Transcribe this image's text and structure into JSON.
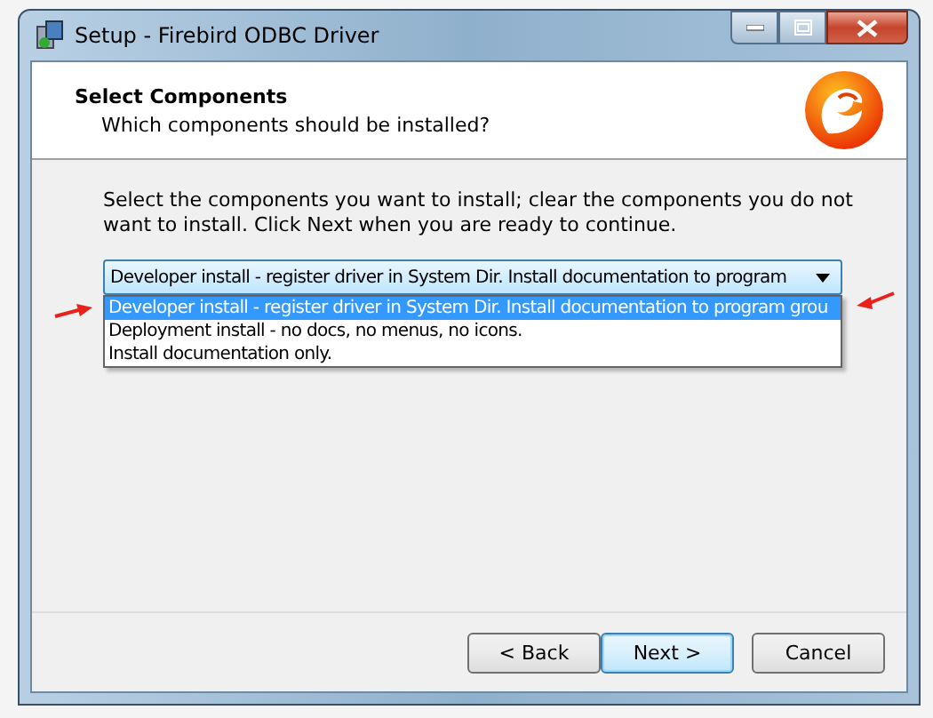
{
  "window": {
    "title": "Setup - Firebird ODBC Driver"
  },
  "header": {
    "title": "Select Components",
    "subtitle": "Which components should be installed?"
  },
  "instructions": "Select the components you want to install; clear the components you do not want to install. Click Next when you are ready to continue.",
  "combo": {
    "value": "Developer install - register driver in System Dir. Install documentation to program",
    "expanded": true,
    "options": [
      {
        "label": "Developer install - register driver in System Dir. Install documentation to program grou",
        "selected": true
      },
      {
        "label": "Deployment install - no docs, no menus, no icons.",
        "selected": false
      },
      {
        "label": "Install documentation only.",
        "selected": false
      }
    ]
  },
  "buttons": [
    {
      "label": "< Back",
      "default": false
    },
    {
      "label": "Next >",
      "default": true
    },
    {
      "label": "Cancel",
      "default": false
    }
  ]
}
